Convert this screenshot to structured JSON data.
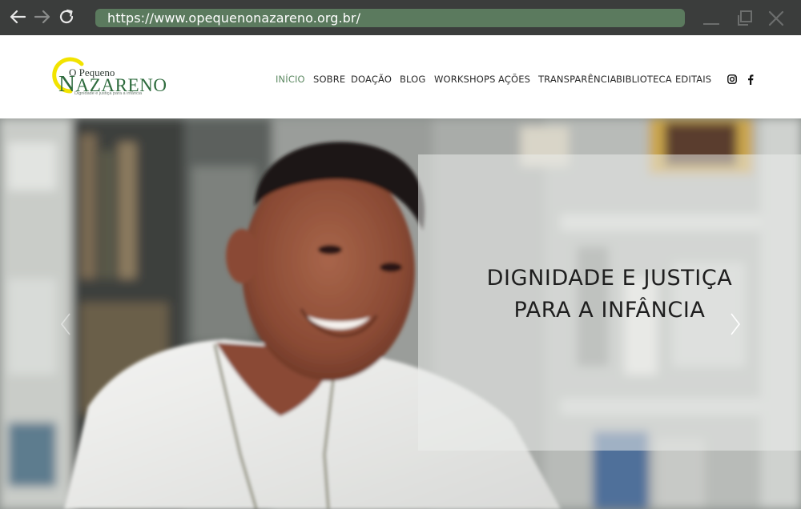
{
  "browser": {
    "url": "https://www.opequenonazareno.org.br/",
    "back_icon": "arrow-left-icon",
    "forward_icon": "arrow-right-icon",
    "reload_icon": "reload-icon",
    "minimize_icon": "minimize-icon",
    "maximize_icon": "maximize-icon",
    "close_icon": "close-icon",
    "colors": {
      "chrome": "#3b3d3c",
      "url_bar": "#5b7a5e"
    }
  },
  "header": {
    "logo": {
      "small_text": "O Pequeno",
      "big_first": "N",
      "big_rest": "AZARENO",
      "tagline": "Dignidade e justiça para a infância",
      "colors": {
        "ring": "#f2e300",
        "text": "#2e6b3d"
      }
    },
    "nav": [
      {
        "label": "INÍCIO",
        "active": true
      },
      {
        "label": "SOBRE",
        "active": false
      },
      {
        "label": "DOAÇÃO",
        "active": false
      },
      {
        "label": "BLOG",
        "active": false
      },
      {
        "label": "WORKSHOPS",
        "active": false
      },
      {
        "label": "AÇÕES",
        "active": false
      },
      {
        "label": "TRANSPARÊNCIA",
        "active": false
      },
      {
        "label": "BIBLIOTECA",
        "active": false
      },
      {
        "label": "EDITAIS",
        "active": false
      }
    ],
    "social": [
      "instagram-icon",
      "facebook-icon"
    ],
    "accent_color": "#5e8a63"
  },
  "hero": {
    "headline_line1": "DIGNIDADE E JUSTIÇA",
    "headline_line2": "PARA A INFÂNCIA",
    "prev_icon": "chevron-left-icon",
    "next_icon": "chevron-right-icon"
  }
}
